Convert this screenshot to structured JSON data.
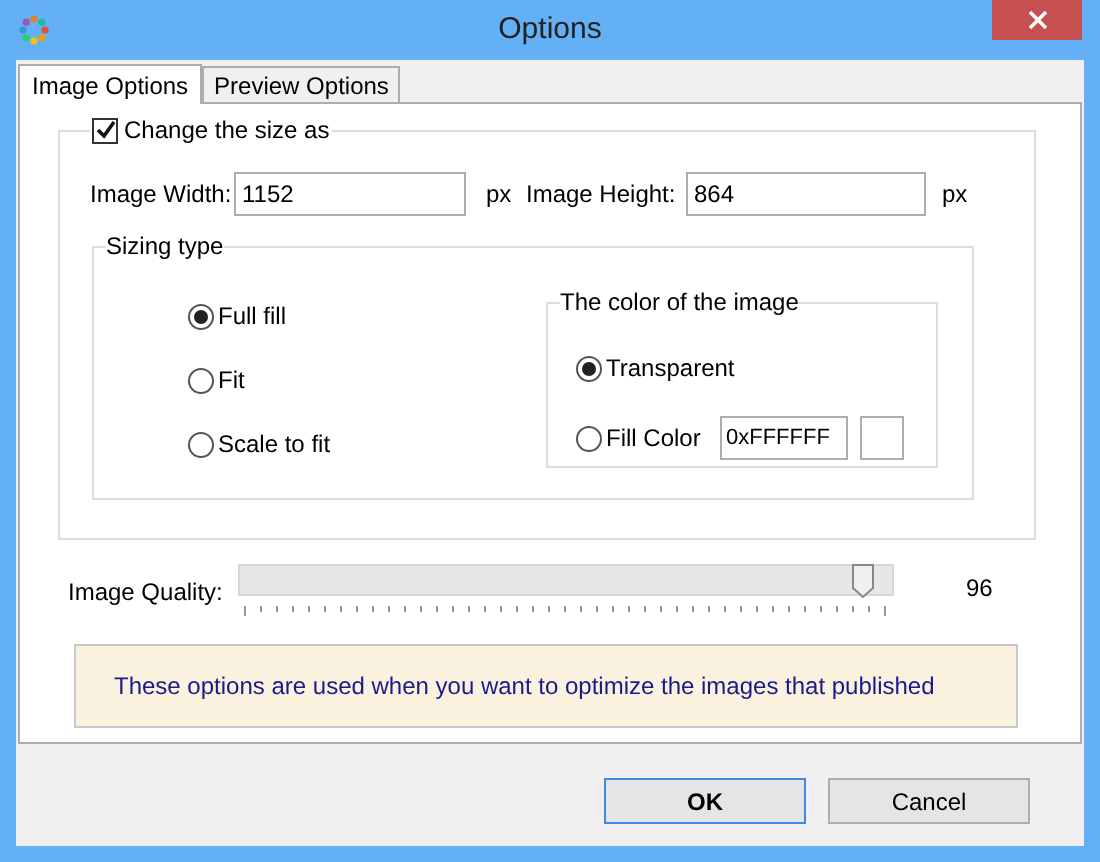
{
  "window": {
    "title": "Options"
  },
  "tabs": [
    {
      "label": "Image Options",
      "selected": true
    },
    {
      "label": "Preview Options",
      "selected": false
    }
  ],
  "resize": {
    "label": "Change the size as",
    "checked": true,
    "width": {
      "label": "Image Width:",
      "value": "1152",
      "unit": "px"
    },
    "height": {
      "label": "Image Height:",
      "value": "864",
      "unit": "px"
    },
    "sizing_type": {
      "title": "Sizing type",
      "options": [
        {
          "label": "Full fill",
          "selected": true
        },
        {
          "label": "Fit",
          "selected": false
        },
        {
          "label": "Scale to fit",
          "selected": false
        }
      ]
    },
    "image_color": {
      "title": "The color of the image",
      "options": [
        {
          "label": "Transparent",
          "selected": true
        },
        {
          "label": "Fill Color",
          "selected": false
        }
      ],
      "color_value": "0xFFFFFF"
    }
  },
  "quality": {
    "label": "Image Quality:",
    "level": 0.96,
    "reading": "96"
  },
  "note": "These options are used when you want to optimize the images that published",
  "buttons": [
    {
      "label": "OK",
      "default": true
    },
    {
      "label": "Cancel",
      "default": false
    }
  ]
}
